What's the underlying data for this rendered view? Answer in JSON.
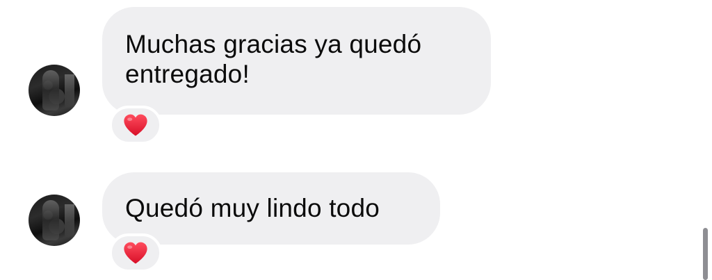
{
  "conversation": {
    "messages": [
      {
        "text_line1": "Muchas gracias ya quedó",
        "text_line2": "entregado!",
        "reaction": "heart-icon"
      },
      {
        "text": "Quedó muy lindo todo",
        "reaction": "heart-icon"
      }
    ]
  },
  "colors": {
    "bubble_background": "#efeff1",
    "text": "#0b0b0b",
    "heart": "#e8132e",
    "scrollbar": "#8e8e93"
  }
}
